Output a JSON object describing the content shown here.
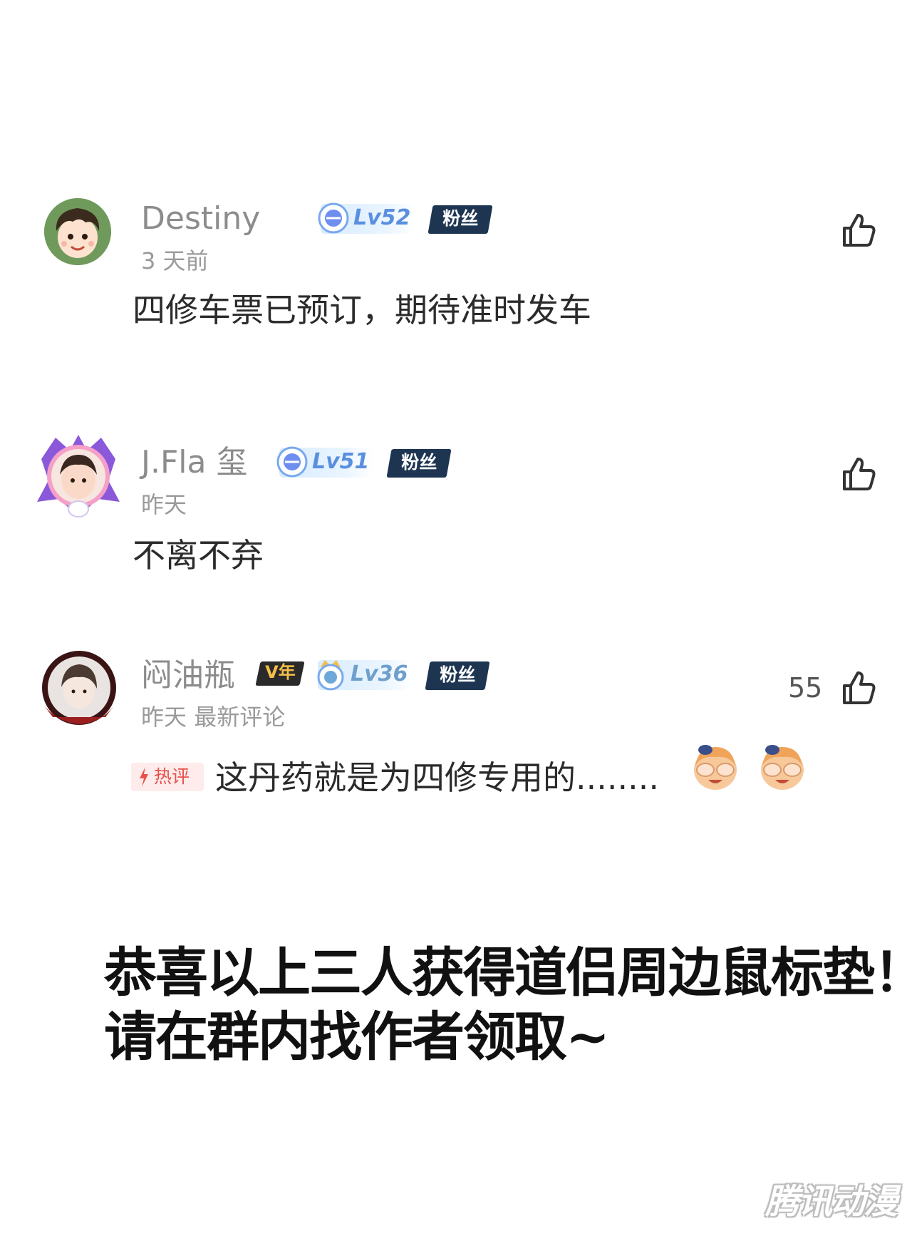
{
  "comments": [
    {
      "username": "Destiny",
      "level": "Lv52",
      "fan_badge": "粉丝",
      "time": "3 天前",
      "content": "四修车票已预订，期待准时发车",
      "avatar": "cartoon-boy-avatar"
    },
    {
      "username": "J.Fla 玺",
      "level": "Lv51",
      "fan_badge": "粉丝",
      "time": "昨天",
      "content": "不离不弃",
      "avatar": "girl-photo-avatar-with-frame"
    },
    {
      "username": "闷油瓶",
      "vip_badge": "V年",
      "level": "Lv36",
      "fan_badge": "粉丝",
      "time": "昨天",
      "time_extra": "最新评论",
      "likes": "55",
      "hot_tag": "热评",
      "content": "这丹药就是为四修专用的........",
      "avatar": "anime-boy-avatar-with-frame",
      "emojis": [
        "covering-eyes-emoji",
        "covering-eyes-emoji"
      ]
    }
  ],
  "announcement": {
    "line1": "恭喜以上三人获得道侣周边鼠标垫！",
    "line2": "请在群内找作者领取~"
  },
  "watermark": "腾讯动漫",
  "colors": {
    "fan_badge_bg": "#1e3552",
    "level_text": "#5a8fe0",
    "hot_tag": "#e8504a",
    "vip_badge_text": "#f2c04a"
  }
}
